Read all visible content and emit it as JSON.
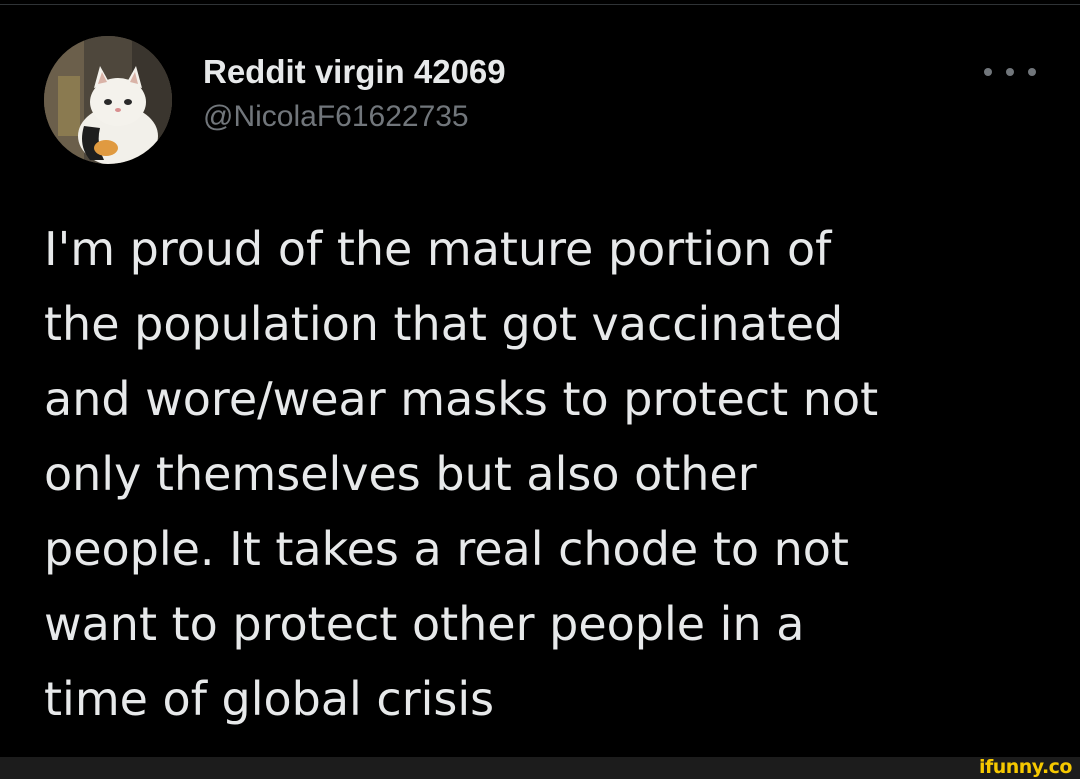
{
  "tweet": {
    "author": {
      "display_name": "Reddit virgin 42069",
      "handle": "@NicolaF61622735",
      "avatar_icon": "cat-avatar-icon"
    },
    "more_icon": "more-options-icon",
    "text_lines": [
      "I'm proud of the mature portion of",
      "the population that got vaccinated",
      "and wore/wear masks to protect not",
      "only themselves but also other",
      "people. It takes a real chode to not",
      "want to protect other people in a",
      "time of global crisis"
    ]
  },
  "watermark": {
    "text": "ifunny.co",
    "color": "#f5c800"
  },
  "colors": {
    "background": "#000000",
    "primary_text": "#e7e9ea",
    "secondary_text": "#71767b"
  }
}
